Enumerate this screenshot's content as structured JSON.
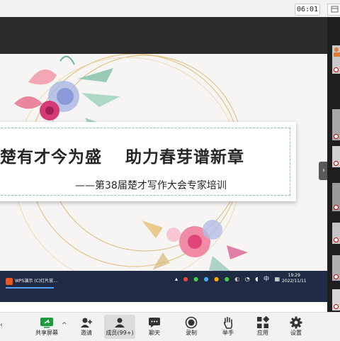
{
  "top": {
    "timer": "06:01",
    "window_ctl": "⊟"
  },
  "slide": {
    "title": "楚有才今为盛　 助力春芽谱新章",
    "subtitle": "——第38届楚才写作大会专家培训"
  },
  "taskbar": {
    "app_label": "WPS演示 (C)灯片放...",
    "tray_lang": "中",
    "time": "19:29",
    "date": "2022/11/11"
  },
  "toolbar": {
    "share_label": "共享屏幕",
    "invite_label": "邀请",
    "members_label": "成员(99+)",
    "chat_label": "聊天",
    "record_label": "录制",
    "hand_label": "举手",
    "apps_label": "应用",
    "settings_label": "设置"
  },
  "icons": {
    "share": "share-screen-icon",
    "invite": "add-user-icon",
    "members": "members-icon",
    "chat": "chat-icon",
    "record": "record-icon",
    "hand": "raise-hand-icon",
    "apps": "apps-icon",
    "settings": "gear-icon"
  },
  "colors": {
    "accent_green": "#1a9b3c",
    "taskbar": "#1f2a44",
    "banner_border": "#8fc4b5"
  }
}
